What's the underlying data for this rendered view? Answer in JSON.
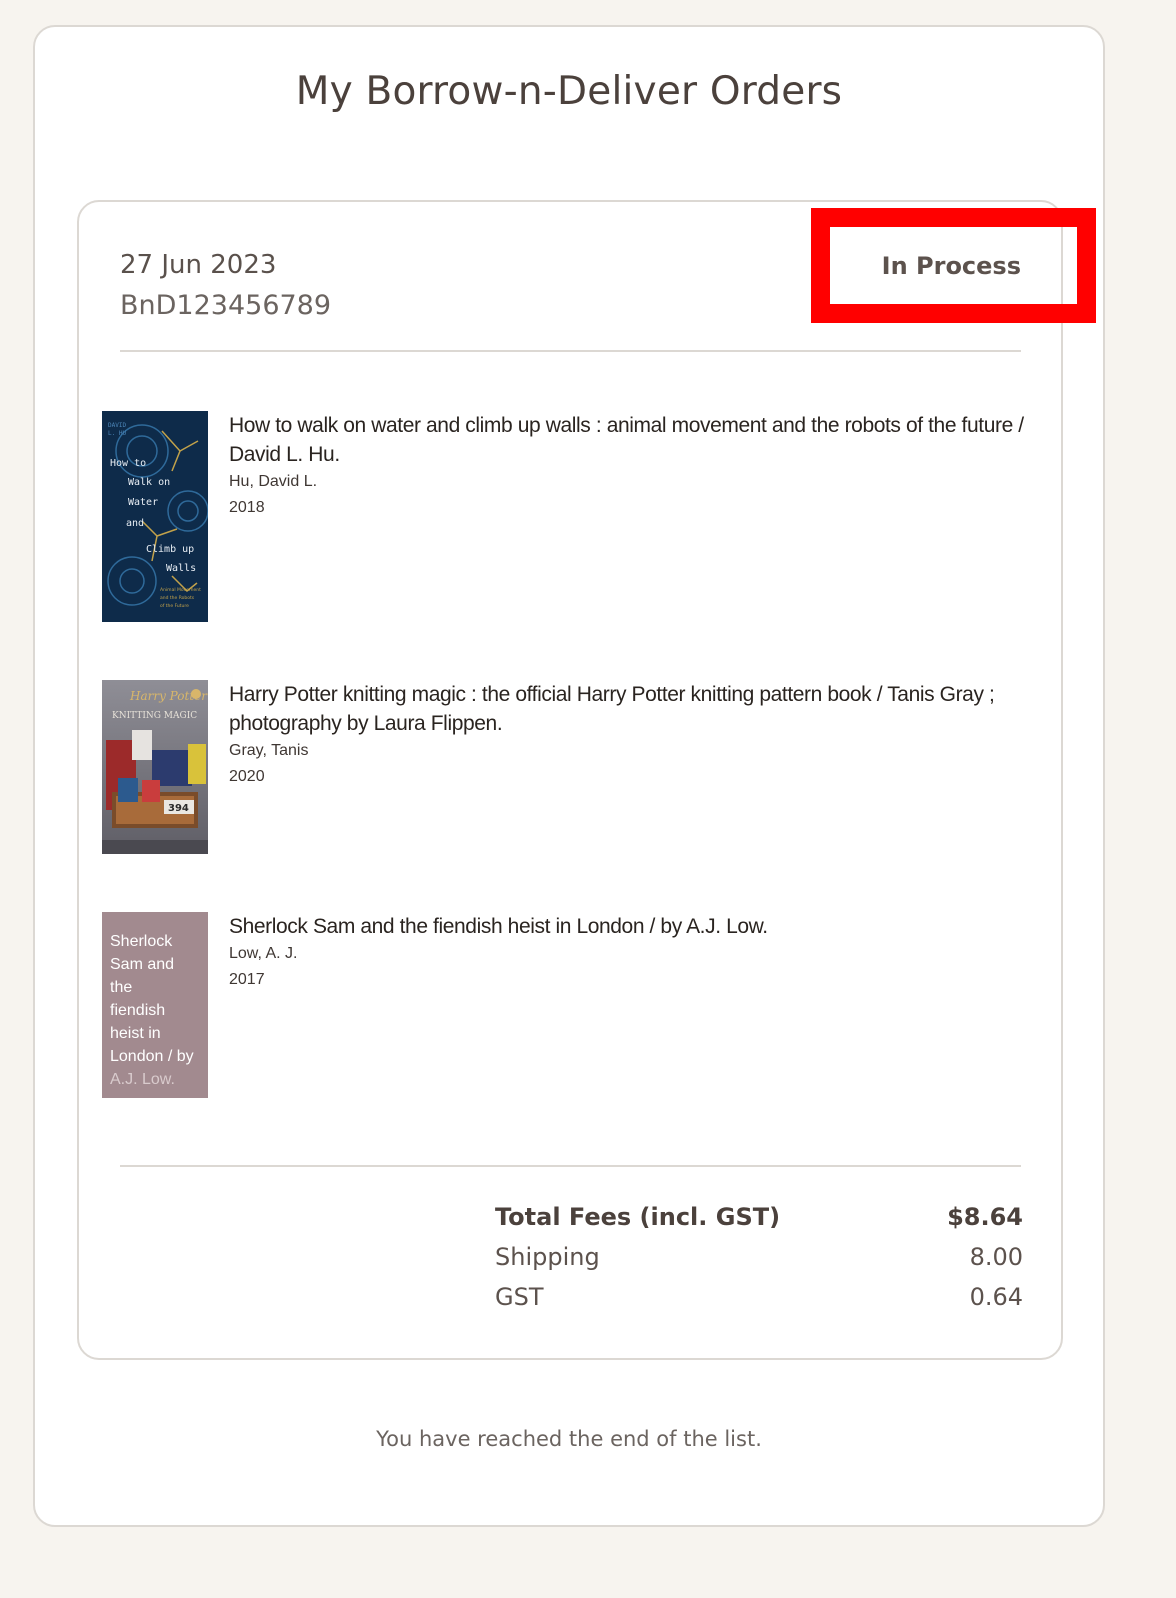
{
  "page": {
    "title": "My Borrow-n-Deliver Orders",
    "end_note": "You have reached the end of the list."
  },
  "order": {
    "date": "27 Jun 2023",
    "id": "BnD123456789",
    "status": "In Process",
    "books": [
      {
        "title": "How to walk on water and climb up walls : animal movement and the robots of the future / David L. Hu.",
        "author": "Hu, David L.",
        "year": "2018",
        "cover": {
          "author_line1": "DAVID",
          "author_line2": "L. HU",
          "title_lines": [
            "How to",
            "Walk on",
            "Water",
            "and",
            "Climb up",
            "Walls"
          ],
          "subtitle_lines": [
            "Animal Movement",
            "and the Robots",
            "of the Future"
          ]
        }
      },
      {
        "title": "Harry Potter knitting magic : the official Harry Potter knitting pattern book / Tanis Gray ; photography by Laura Flippen.",
        "author": "Gray, Tanis",
        "year": "2020",
        "cover": {
          "brand": "Harry Potter",
          "subtitle": "KNITTING MAGIC",
          "number": "394"
        }
      },
      {
        "title": "Sherlock Sam and the fiendish heist in London / by A.J. Low.",
        "author": "Low, A. J.",
        "year": "2017",
        "cover": {
          "lines": [
            "Sherlock",
            "Sam and the",
            "fiendish",
            "heist in",
            "London / by"
          ],
          "faded_line": "A.J. Low."
        }
      }
    ],
    "fees": {
      "total_label": "Total Fees (incl. GST)",
      "total_value": "$8.64",
      "shipping_label": "Shipping",
      "shipping_value": "8.00",
      "gst_label": "GST",
      "gst_value": "0.64"
    }
  },
  "colors": {
    "page_bg": "#f7f4ef",
    "highlight": "#ff0000",
    "cover_1": "#0e2b4a",
    "cover_3": "#a28a8f"
  }
}
